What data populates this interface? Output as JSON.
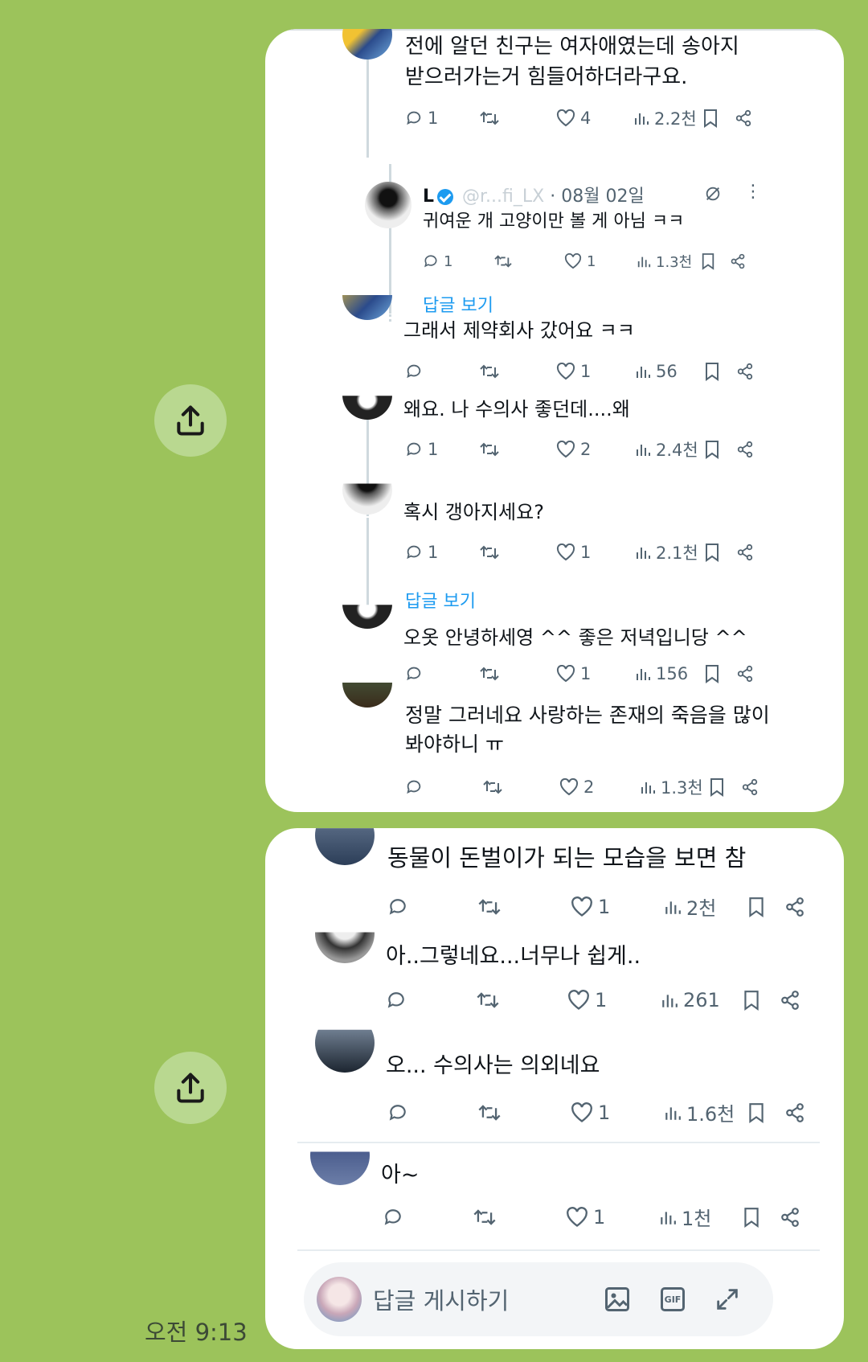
{
  "timestamp": "오전 9:13",
  "screenshot1": {
    "posts": [
      {
        "text_line1": "전에 알던 친구는 여자애였는데 송아지",
        "text_line2": "받으러가는거 힘들어하더라구요.",
        "replies": "1",
        "likes": "4",
        "views": "2.2천"
      },
      {
        "author": "L",
        "handle": "@r...fi_LX",
        "date": "· 08월 02일",
        "text": "귀여운 개 고양이만 볼 게 아님 ㅋㅋ",
        "replies": "1",
        "likes": "1",
        "views": "1.3천"
      },
      {
        "show_replies": "답글 보기",
        "text": "그래서 제약회사 갔어요 ㅋㅋ",
        "replies": "",
        "likes": "1",
        "views": "56"
      },
      {
        "text": "왜요.  나 수의사 좋던데....왜",
        "replies": "1",
        "likes": "2",
        "views": "2.4천"
      },
      {
        "text": "혹시 갱아지세요?",
        "replies": "1",
        "likes": "1",
        "views": "2.1천"
      },
      {
        "show_replies": "답글 보기",
        "text": "오옷 안녕하세영 ^^   좋은 저녁입니당 ^^",
        "replies": "",
        "likes": "1",
        "views": "156"
      },
      {
        "text_line1": "정말 그러네요 사랑하는 존재의 죽음을 많이",
        "text_line2": "봐야하니 ㅠ",
        "replies": "",
        "likes": "2",
        "views": "1.3천"
      }
    ]
  },
  "screenshot2": {
    "posts": [
      {
        "text": "동물이 돈벌이가 되는 모습을 보면 참",
        "replies": "",
        "likes": "1",
        "views": "2천"
      },
      {
        "text": "아..그렇네요...너무나 쉽게..",
        "replies": "",
        "likes": "1",
        "views": "261"
      },
      {
        "text": "오... 수의사는 의외네요",
        "replies": "",
        "likes": "1",
        "views": "1.6천"
      },
      {
        "text": "아~",
        "replies": "",
        "likes": "1",
        "views": "1천"
      }
    ],
    "composer_placeholder": "답글 게시하기"
  }
}
